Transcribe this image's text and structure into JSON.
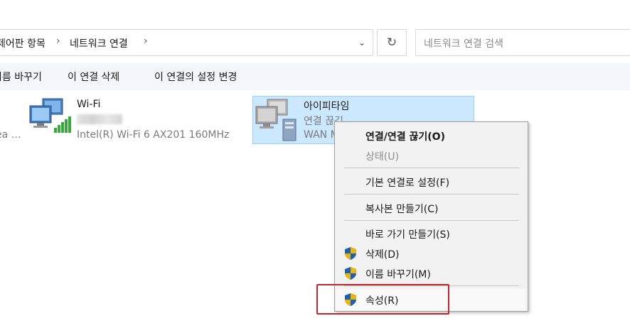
{
  "address": {
    "crumbs": [
      "제어판 항목",
      "네트워크 연결"
    ],
    "separator": "›",
    "dropdown_glyph": "⌄",
    "refresh_glyph": "↻",
    "search_placeholder": "네트워크 연결 검색"
  },
  "toolbar": {
    "items": [
      "이름 바꾸기",
      "이 연결 삭제",
      "이 연결의 설정 변경"
    ]
  },
  "connections": [
    {
      "partial_label": "ea …",
      "name": "Wi-Fi",
      "adapter": "Intel(R) Wi-Fi 6 AX201 160MHz"
    },
    {
      "name": "아이피타임",
      "status": "연결 끊김",
      "adapter": "WAN M"
    }
  ],
  "context_menu": {
    "items": [
      {
        "label": "연결/연결 끊기(O)",
        "style": "bold"
      },
      {
        "label": "상태(U)",
        "style": "disabled"
      },
      {
        "label": "기본 연결로 설정(F)",
        "style": "normal"
      },
      {
        "label": "복사본 만들기(C)",
        "style": "normal"
      },
      {
        "label": "바로 가기 만들기(S)",
        "style": "normal"
      },
      {
        "label": "삭제(D)",
        "style": "shield"
      },
      {
        "label": "이름 바꾸기(M)",
        "style": "shield"
      },
      {
        "label": "속성(R)",
        "style": "shield",
        "highlighted": true
      }
    ]
  },
  "colors": {
    "selection_bg": "#cce8ff",
    "selection_border": "#99d1ff",
    "highlight_box": "#c0272d",
    "command_bar_bg": "#f3f6fa",
    "shield_blue": "#1e5fb4",
    "shield_gold": "#e8b50c"
  }
}
